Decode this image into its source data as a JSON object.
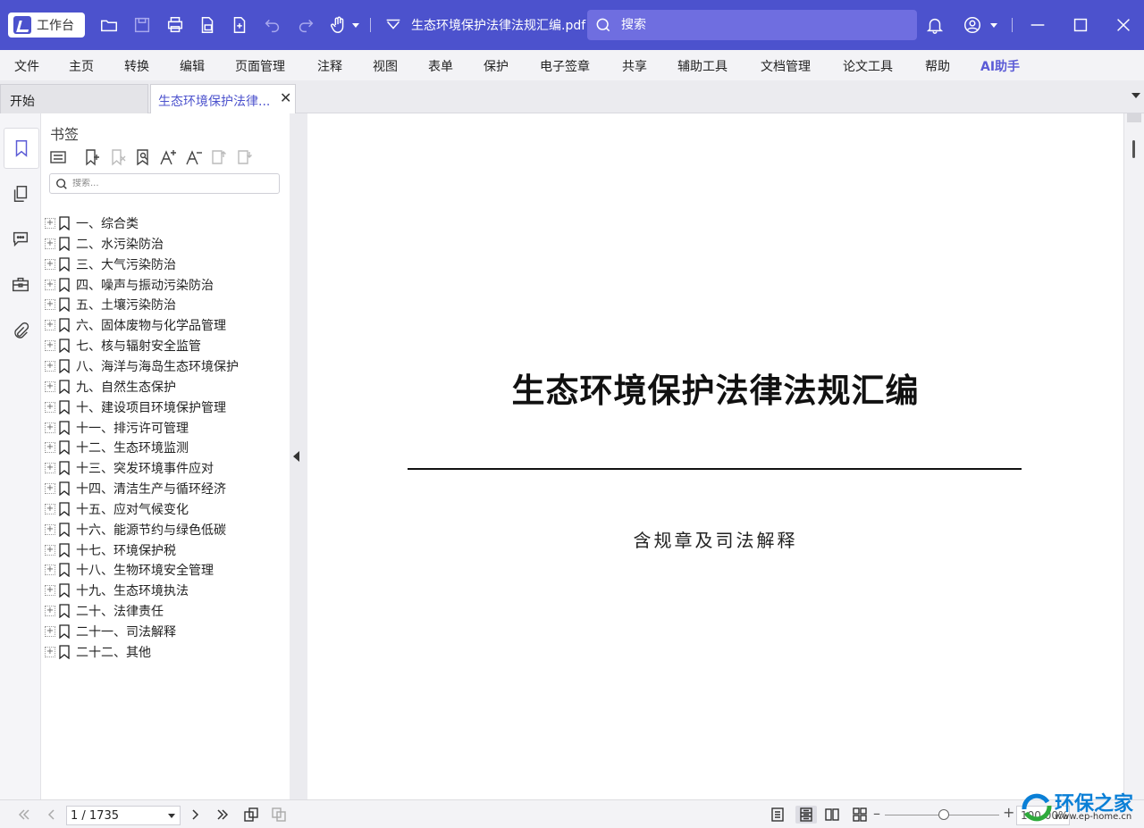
{
  "titlebar": {
    "workbench_label": "工作台",
    "document_title": "生态环境保护法律法规汇编.pdf",
    "search_placeholder": "搜索"
  },
  "menubar": {
    "items": [
      "文件",
      "主页",
      "转换",
      "编辑",
      "页面管理",
      "注释",
      "视图",
      "表单",
      "保护",
      "电子签章",
      "共享",
      "辅助工具",
      "文档管理",
      "论文工具",
      "帮助",
      "AI助手"
    ]
  },
  "tabs": {
    "start": "开始",
    "document": "生态环境保护法律..."
  },
  "bookmarks": {
    "title": "书签",
    "search_placeholder": "搜索...",
    "items": [
      "一、综合类",
      "二、水污染防治",
      "三、大气污染防治",
      "四、噪声与振动污染防治",
      "五、土壤污染防治",
      "六、固体废物与化学品管理",
      "七、核与辐射安全监管",
      "八、海洋与海岛生态环境保护",
      "九、自然生态保护",
      "十、建设项目环境保护管理",
      "十一、排污许可管理",
      "十二、生态环境监测",
      "十三、突发环境事件应对",
      "十四、清洁生产与循环经济",
      "十五、应对气候变化",
      "十六、能源节约与绿色低碳",
      "十七、环境保护税",
      "十八、生物环境安全管理",
      "十九、生态环境执法",
      "二十、法律责任",
      "二十一、司法解释",
      "二十二、其他"
    ]
  },
  "page": {
    "title": "生态环境保护法律法规汇编",
    "subtitle": "含规章及司法解释"
  },
  "statusbar": {
    "page_indicator": "1 / 1735",
    "zoom": "100.00%"
  },
  "watermark": {
    "name": "环保之家",
    "url": "www.ep-home.cn"
  },
  "colors": {
    "titlebar": "#4c52cd",
    "accent": "#5b5bd6"
  }
}
